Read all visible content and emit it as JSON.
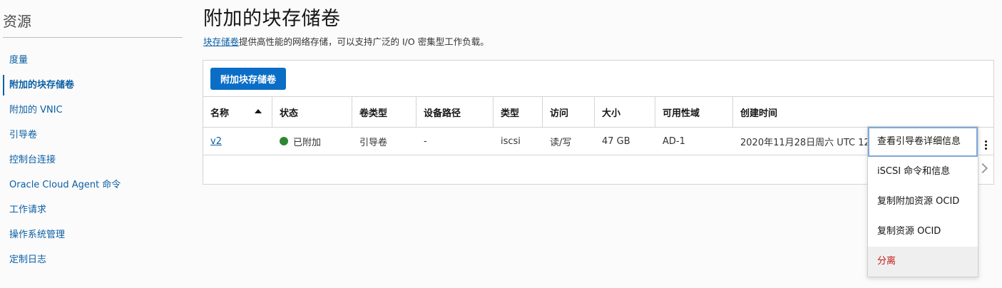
{
  "sidebar": {
    "title": "资源",
    "items": [
      {
        "label": "度量",
        "active": false
      },
      {
        "label": "附加的块存储卷",
        "active": true
      },
      {
        "label": "附加的 VNIC",
        "active": false
      },
      {
        "label": "引导卷",
        "active": false
      },
      {
        "label": "控制台连接",
        "active": false
      },
      {
        "label": "Oracle Cloud Agent 命令",
        "active": false
      },
      {
        "label": "工作请求",
        "active": false
      },
      {
        "label": "操作系统管理",
        "active": false
      },
      {
        "label": "定制日志",
        "active": false
      }
    ]
  },
  "main": {
    "title": "附加的块存储卷",
    "description_link": "块存储卷",
    "description_text": "提供高性能的网络存储，可以支持广泛的 I/O 密集型工作负载。",
    "primary_button": "附加块存储卷"
  },
  "table": {
    "columns": [
      "名称",
      "状态",
      "卷类型",
      "设备路径",
      "类型",
      "访问",
      "大小",
      "可用性域",
      "创建时间"
    ],
    "sort_column": "名称",
    "sort_direction": "ascending",
    "rows": [
      {
        "name": "v2",
        "status": "已附加",
        "volume_type": "引导卷",
        "device_path": "-",
        "type": "iscsi",
        "access": "读/写",
        "size": "47 GB",
        "availability_domain": "AD-1",
        "created": "2020年11月28日周六 UTC 12"
      }
    ]
  },
  "action_menu": {
    "items": [
      {
        "label": "查看引导卷详细信息"
      },
      {
        "label": "iSCSI 命令和信息"
      },
      {
        "label": "复制附加资源 OCID"
      },
      {
        "label": "复制资源 OCID"
      },
      {
        "label": "分离"
      }
    ]
  },
  "colors": {
    "accent": "#0a6ec6",
    "link": "#0b5fa5",
    "status_attached": "#2f8732",
    "danger": "#c41a1a"
  },
  "icons": {
    "sort": "sort-ascending-icon",
    "status": "status-dot-icon",
    "more": "kebab-menu-icon",
    "next": "chevron-right-icon"
  }
}
